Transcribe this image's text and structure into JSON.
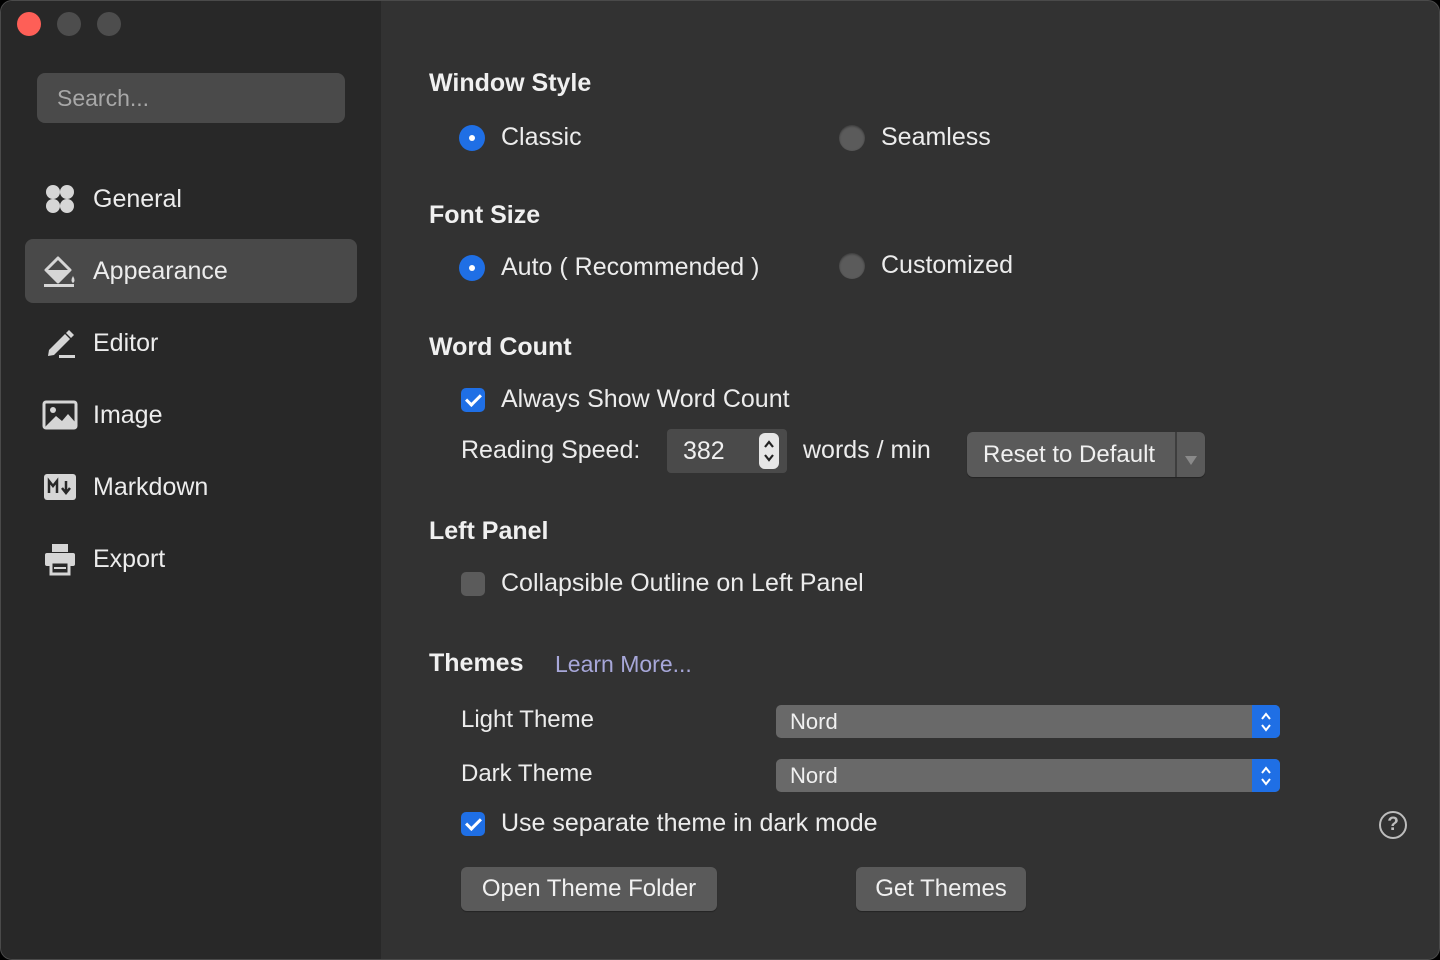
{
  "sidebar": {
    "search_placeholder": "Search...",
    "items": [
      {
        "label": "General",
        "icon": "grid-icon"
      },
      {
        "label": "Appearance",
        "icon": "paint-bucket-icon",
        "active": true
      },
      {
        "label": "Editor",
        "icon": "pencil-icon"
      },
      {
        "label": "Image",
        "icon": "image-icon"
      },
      {
        "label": "Markdown",
        "icon": "markdown-icon"
      },
      {
        "label": "Export",
        "icon": "printer-icon"
      }
    ]
  },
  "window_style": {
    "title": "Window Style",
    "options": [
      "Classic",
      "Seamless"
    ],
    "selected": "Classic"
  },
  "font_size": {
    "title": "Font Size",
    "options": [
      "Auto ( Recommended )",
      "Customized"
    ],
    "selected": "Auto ( Recommended )"
  },
  "word_count": {
    "title": "Word Count",
    "always_show_label": "Always Show Word Count",
    "always_show_checked": true,
    "reading_speed_label": "Reading Speed:",
    "reading_speed_value": "382",
    "reading_speed_unit": "words / min",
    "reset_label": "Reset to Default"
  },
  "left_panel": {
    "title": "Left Panel",
    "collapsible_label": "Collapsible Outline on Left Panel",
    "collapsible_checked": false
  },
  "themes": {
    "title": "Themes",
    "learn_more": "Learn More...",
    "light_label": "Light Theme",
    "light_value": "Nord",
    "dark_label": "Dark Theme",
    "dark_value": "Nord",
    "separate_label": "Use separate theme in dark mode",
    "separate_checked": true,
    "help_glyph": "?",
    "open_folder_label": "Open Theme Folder",
    "get_themes_label": "Get Themes"
  },
  "colors": {
    "accent": "#1f6fe5",
    "sidebar_bg": "#282828",
    "content_bg": "#323232",
    "close_button": "#fe5f57"
  }
}
